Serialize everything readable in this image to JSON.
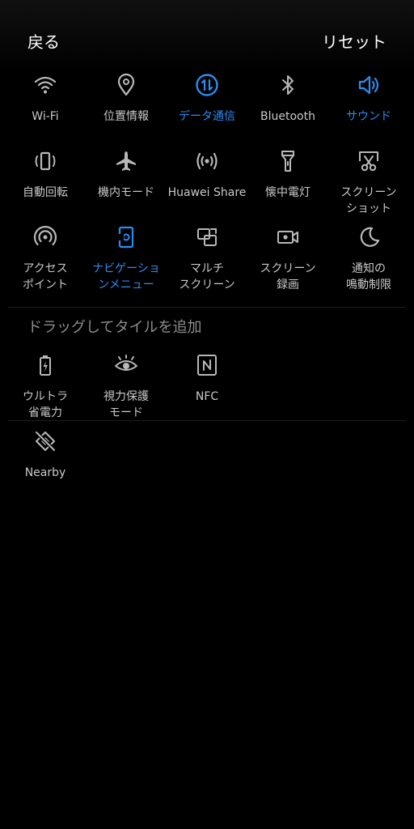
{
  "header": {
    "back_label": "戻る",
    "reset_label": "リセット"
  },
  "colors": {
    "active": "#2b8cf0",
    "inactive": "#b8b8b8",
    "background": "#000000"
  },
  "active_tiles": [
    {
      "label": "Wi-Fi",
      "icon": "wifi-icon",
      "active": false
    },
    {
      "label": "位置情報",
      "icon": "location-icon",
      "active": false
    },
    {
      "label": "データ通信",
      "icon": "data-transfer-icon",
      "active": true
    },
    {
      "label": "Bluetooth",
      "icon": "bluetooth-icon",
      "active": false
    },
    {
      "label": "サウンド",
      "icon": "sound-icon",
      "active": true
    },
    {
      "label": "自動回転",
      "icon": "auto-rotate-icon",
      "active": false
    },
    {
      "label": "機内モード",
      "icon": "airplane-icon",
      "active": false
    },
    {
      "label": "Huawei Share",
      "icon": "huawei-share-icon",
      "active": false
    },
    {
      "label": "懐中電灯",
      "icon": "flashlight-icon",
      "active": false
    },
    {
      "label": "スクリーン\nショット",
      "icon": "screenshot-icon",
      "active": false
    },
    {
      "label": "アクセス\nポイント",
      "icon": "hotspot-icon",
      "active": false
    },
    {
      "label": "ナビゲーショ\nンメニュー",
      "icon": "navigation-menu-icon",
      "active": true
    },
    {
      "label": "マルチ\nスクリーン",
      "icon": "multi-screen-icon",
      "active": false
    },
    {
      "label": "スクリーン\n録画",
      "icon": "screen-record-icon",
      "active": false
    },
    {
      "label": "通知の\n鳴動制限",
      "icon": "moon-icon",
      "active": false
    }
  ],
  "section": {
    "title": "ドラッグしてタイルを追加"
  },
  "available_tiles": [
    {
      "label": "ウルトラ\n省電力",
      "icon": "battery-saver-icon"
    },
    {
      "label": "視力保護\nモード",
      "icon": "eye-icon"
    },
    {
      "label": "NFC",
      "icon": "nfc-icon"
    }
  ],
  "extra_tiles": [
    {
      "label": "Nearby",
      "icon": "nearby-off-icon"
    }
  ]
}
